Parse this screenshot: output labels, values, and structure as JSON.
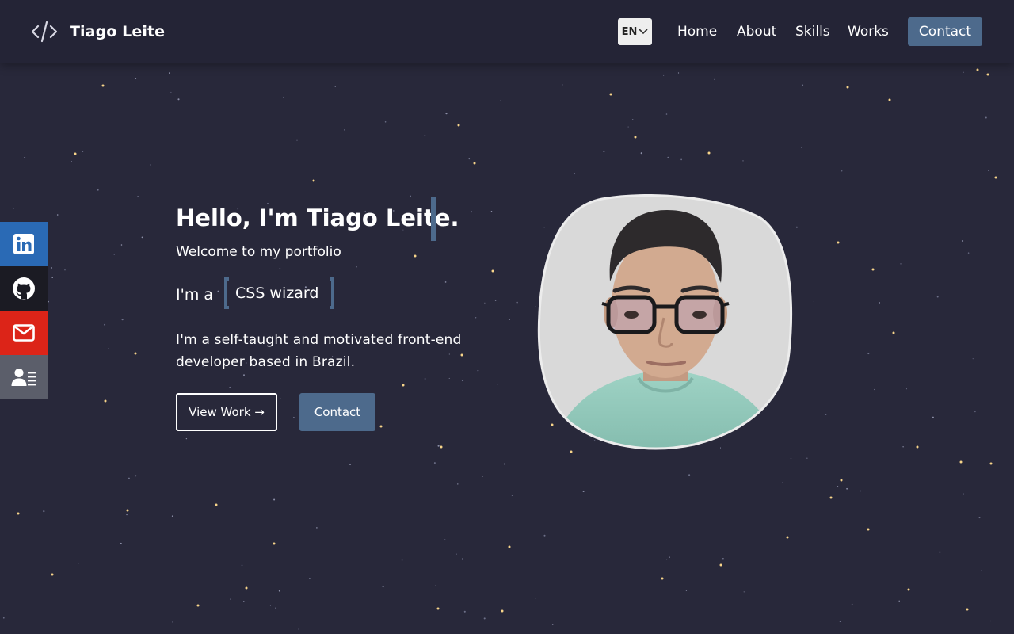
{
  "header": {
    "brand_name": "Tiago Leite",
    "language": "EN",
    "nav": {
      "home": "Home",
      "about": "About",
      "skills": "Skills",
      "works": "Works",
      "contact": "Contact"
    }
  },
  "social": [
    {
      "name": "linkedin",
      "icon": "linkedin-icon",
      "color": "#2a6ab5"
    },
    {
      "name": "github",
      "icon": "github-icon",
      "color": "#1b1b23"
    },
    {
      "name": "email",
      "icon": "mail-icon",
      "color": "#dc2418"
    },
    {
      "name": "contact-card",
      "icon": "contact-card-icon",
      "color": "#5b5e6a"
    }
  ],
  "hero": {
    "title": "Hello, I'm Tiago Leite.",
    "welcome": "Welcome to my portfolio",
    "role_prefix": "I'm a",
    "role": "CSS wizard",
    "description": "I'm a self-taught and motivated front-end developer based in Brazil.",
    "view_work_label": "View Work →",
    "contact_label": "Contact"
  },
  "colors": {
    "background": "#28283a",
    "navbar": "#242436",
    "accent": "#4d6a8c",
    "star": "#f7d58a"
  }
}
